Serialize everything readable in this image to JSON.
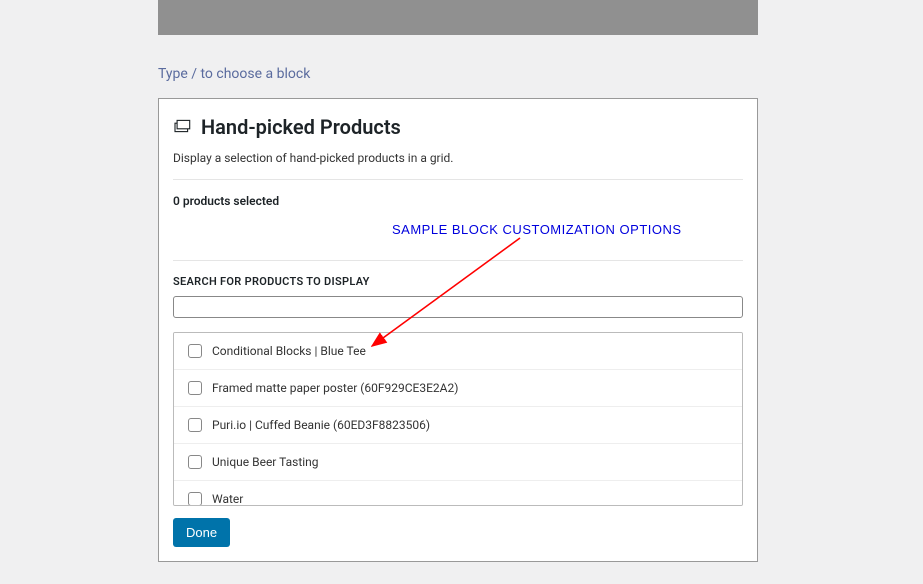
{
  "editor": {
    "placeholder_text": "Type / to choose a block"
  },
  "block": {
    "title": "Hand-picked Products",
    "description": "Display a selection of hand-picked products in a grid.",
    "selected_count_text": "0 products selected",
    "search_label": "SEARCH FOR PRODUCTS TO DISPLAY",
    "search_value": "",
    "products": [
      {
        "label": "Conditional Blocks | Blue Tee",
        "checked": false
      },
      {
        "label": "Framed matte paper poster (60F929CE3E2A2)",
        "checked": false
      },
      {
        "label": "Puri.io | Cuffed Beanie (60ED3F8823506)",
        "checked": false
      },
      {
        "label": "Unique Beer Tasting",
        "checked": false
      },
      {
        "label": "Water",
        "checked": false
      }
    ],
    "done_label": "Done"
  },
  "annotation": {
    "text": "SAMPLE BLOCK CUSTOMIZATION OPTIONS",
    "arrow_color": "#ff0000"
  }
}
